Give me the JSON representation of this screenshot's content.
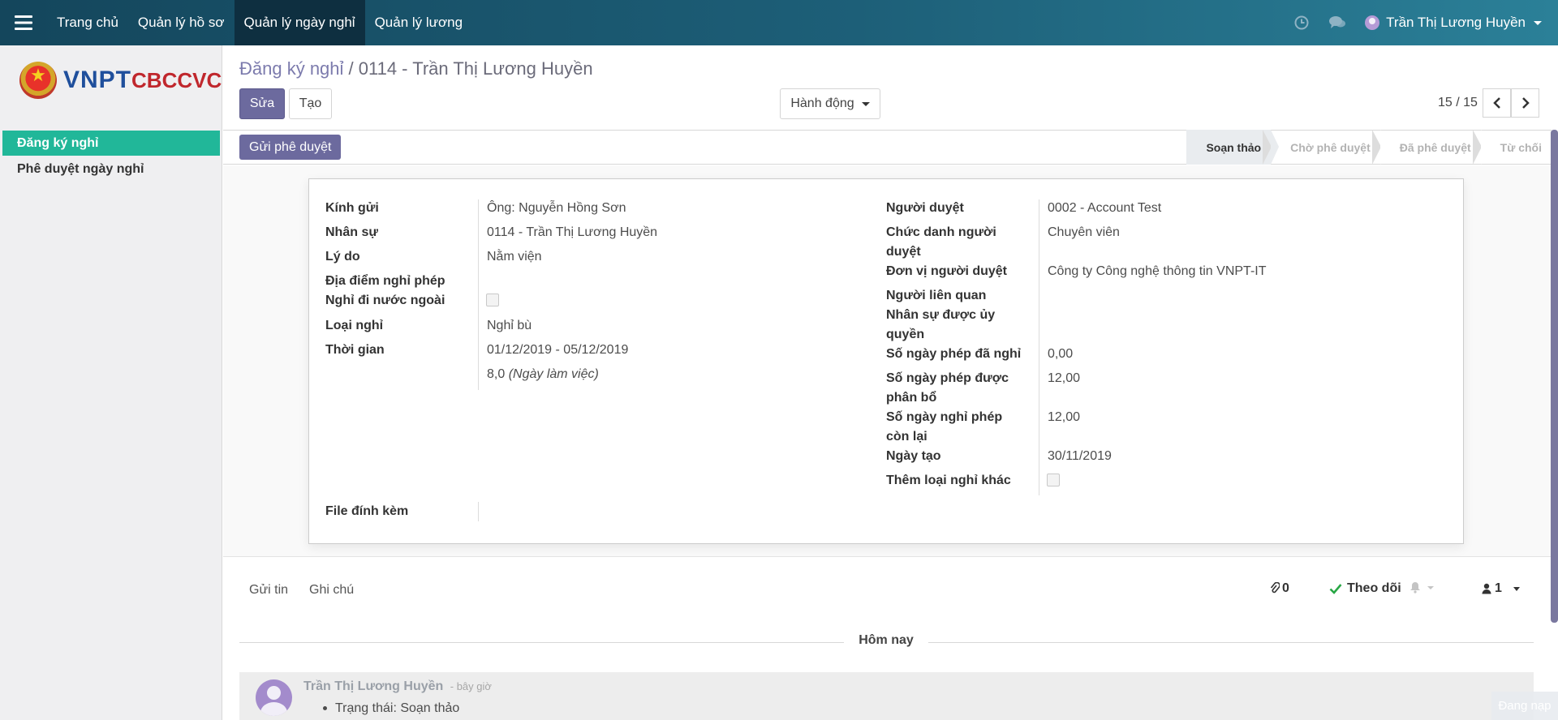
{
  "topbar": {
    "nav": [
      "Trang chủ",
      "Quản lý hồ sơ",
      "Quản lý ngày nghỉ",
      "Quản lý lương"
    ],
    "user_name": "Trần Thị Lương Huyền",
    "icons": [
      "menu-icon",
      "clock-icon",
      "chat-icon",
      "caret-down-icon"
    ]
  },
  "logo": {
    "text_blue": "VNPT",
    "text_red": "CBCCVC"
  },
  "sidebar": {
    "items": [
      "Đăng ký nghỉ",
      "Phê duyệt ngày nghỉ"
    ]
  },
  "header": {
    "breadcrumb_parent": "Đăng ký nghỉ",
    "breadcrumb_sep": " / ",
    "breadcrumb_current": "0114 - Trần Thị Lương Huyền",
    "edit_label": "Sửa",
    "create_label": "Tạo",
    "action_label": "Hành động",
    "pager": "15 / 15"
  },
  "status": {
    "send_label": "Gửi phê duyệt",
    "stages": [
      "Soạn thảo",
      "Chờ phê duyệt",
      "Đã phê duyệt",
      "Từ chối"
    ],
    "current_stage": "Soạn thảo"
  },
  "form": {
    "left": {
      "kinh_gui_label": "Kính gửi",
      "kinh_gui": "Ông: Nguyễn Hồng Sơn",
      "nhan_su_label": "Nhân sự",
      "nhan_su": "0114 - Trần Thị Lương Huyền",
      "ly_do_label": "Lý do",
      "ly_do": "Nằm viện",
      "dia_diem_label": "Địa điểm nghỉ phép",
      "nuoc_ngoai_label": "Nghỉ đi nước ngoài",
      "loai_nghi_label": "Loại nghỉ",
      "loai_nghi": "Nghỉ bù",
      "thoi_gian_label": "Thời gian",
      "thoi_gian": "01/12/2019 - 05/12/2019",
      "so_ngay": "8,0",
      "so_ngay_unit": "(Ngày làm việc)",
      "file_label": "File đính kèm"
    },
    "right": {
      "nguoi_duyet_label": "Người duyệt",
      "nguoi_duyet": "0002 - Account Test",
      "chuc_danh_label_1": "Chức danh người",
      "chuc_danh_label_2": "duyệt",
      "chuc_danh": "Chuyên viên",
      "don_vi_label": "Đơn vị người duyệt",
      "don_vi": "Công ty Công nghệ thông tin VNPT-IT",
      "lien_quan_label": "Người liên quan",
      "uy_quyen_label_1": "Nhân sự được ủy",
      "uy_quyen_label_2": "quyền",
      "da_nghi_label": "Số ngày phép đã nghỉ",
      "da_nghi": "0,00",
      "phan_bo_label_1": "Số ngày phép được",
      "phan_bo_label_2": "phân bổ",
      "phan_bo": "12,00",
      "con_lai_label_1": "Số ngày nghỉ phép",
      "con_lai_label_2": "còn lại",
      "con_lai": "12,00",
      "ngay_tao_label": "Ngày tạo",
      "ngay_tao": "30/11/2019",
      "them_loai_label": "Thêm loại nghỉ khác"
    }
  },
  "chatter": {
    "send_message": "Gửi tin",
    "log_note": "Ghi chú",
    "attachments": "0",
    "follow_label": "Theo dõi",
    "followers": "1",
    "today_label": "Hôm nay",
    "author": "Trần Thị Lương Huyền",
    "time": "- bây giờ",
    "change": "Trạng thái: Soạn thảo"
  },
  "loading_label": "Đang nạp",
  "colors": {
    "primary": "#6c6a9e",
    "sidebar_active": "#21b799",
    "topbar": "#14465c"
  }
}
